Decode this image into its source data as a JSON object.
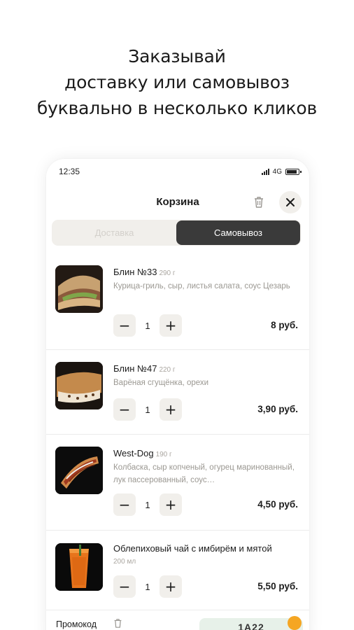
{
  "headline": {
    "line1": "Заказывай",
    "line2": "доставку или самовывоз",
    "line3": "буквально в несколько кликов"
  },
  "status_bar": {
    "time": "12:35",
    "network": "4G"
  },
  "header": {
    "title": "Корзина",
    "icons": [
      "trash-icon",
      "close-icon"
    ]
  },
  "tabs": [
    {
      "label": "Доставка",
      "active": false
    },
    {
      "label": "Самовывоз",
      "active": true
    }
  ],
  "items": [
    {
      "name": "Блин №33",
      "weight": "290 г",
      "desc": "Курица-гриль, сыр, листья салата, соус Цезарь",
      "qty": "1",
      "price": "8 руб."
    },
    {
      "name": "Блин №47",
      "weight": "220 г",
      "desc": "Варёная сгущёнка, орехи",
      "qty": "1",
      "price": "3,90 руб."
    },
    {
      "name": "West-Dog",
      "weight": "190 г",
      "desc": "Колбаска, сыр копченый, огурец маринованный, лук пассерованный, соус…",
      "qty": "1",
      "price": "4,50 руб."
    },
    {
      "name": "Облепиховый чай с имбирём и мятой",
      "weight": "200 мл",
      "desc": "",
      "qty": "1",
      "price": "5,50 руб."
    }
  ],
  "controls": {
    "minus": "−",
    "plus": "+"
  },
  "promo": {
    "label": "Промокод",
    "code": "1А22"
  },
  "colors": {
    "accent_dark": "#3a3a3a",
    "segment_bg": "#f1efeb",
    "promo_bg": "#e7f1e9"
  }
}
